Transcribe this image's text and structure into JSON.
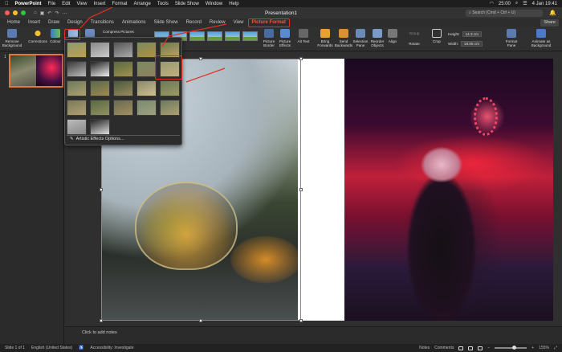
{
  "menubar": {
    "apple": "",
    "app_name": "PowerPoint",
    "items": [
      "File",
      "Edit",
      "View",
      "Insert",
      "Format",
      "Arrange",
      "Tools",
      "Slide Show",
      "Window",
      "Help"
    ],
    "time": "25:00",
    "date": "4 Jan 19:41"
  },
  "titlebar": {
    "doc_title": "Presentation1",
    "search_placeholder": "Search (Cmd + Ctrl + U)"
  },
  "tabs": [
    "Home",
    "Insert",
    "Draw",
    "Design",
    "Transitions",
    "Animations",
    "Slide Show",
    "Record",
    "Review",
    "View",
    "Picture Format"
  ],
  "active_tab": "Picture Format",
  "share_label": "Share",
  "ribbon": {
    "remove_background": "Remove Background",
    "corrections": "Corrections",
    "colour": "Colour",
    "compress_pictures": "Compress Pictures",
    "change_picture": "Change Picture",
    "picture_border": "Picture Border",
    "picture_effects": "Picture Effects",
    "alt_text": "Alt Text",
    "bring_forwards": "Bring Forwards",
    "send_backwards": "Send Backwards",
    "selection_pane": "Selection Pane",
    "reorder_objects": "Reorder Objects",
    "align": "Align",
    "group": "Group",
    "rotate": "Rotate",
    "crop": "Crop",
    "height_label": "Height:",
    "height_value": "14.3 cm",
    "width_label": "Width:",
    "width_value": "18.05 cm",
    "format_pane": "Format Pane",
    "animate_as_background": "Animate as Background"
  },
  "dropdown": {
    "option_label": "Artistic Effects Options..."
  },
  "slide_panel": {
    "slide_number": "1"
  },
  "notes_placeholder": "Click to add notes",
  "statusbar": {
    "slide_info": "Slide 1 of 1",
    "language": "English (United States)",
    "accessibility": "Accessibility: Investigate",
    "notes": "Notes",
    "comments": "Comments",
    "zoom": "155%"
  },
  "colors": {
    "accent": "#e03020",
    "tab_active": "#f05a3a"
  }
}
